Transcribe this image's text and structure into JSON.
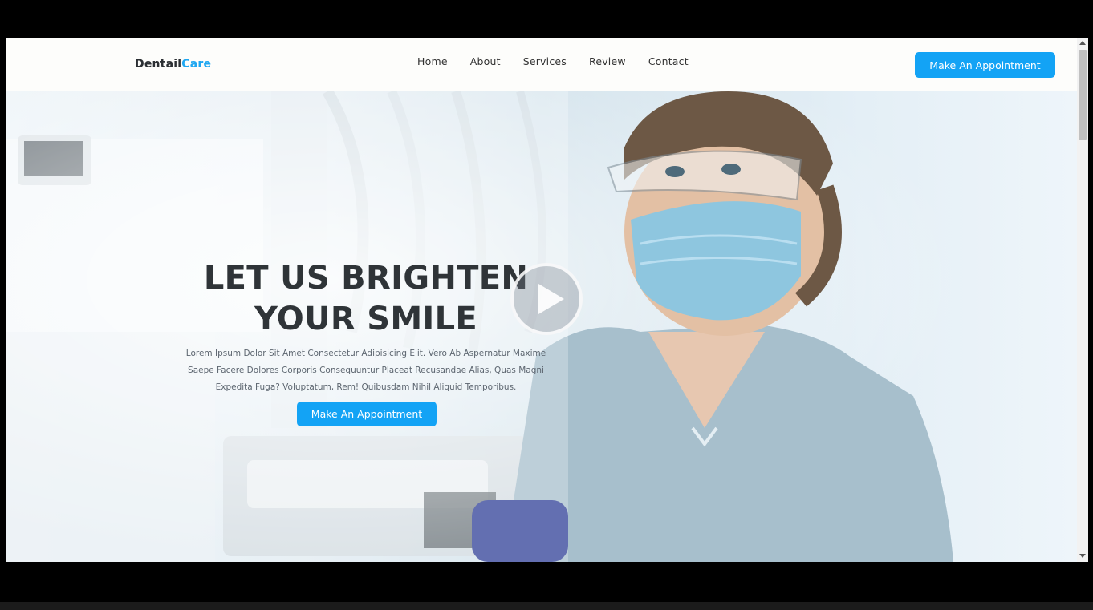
{
  "logo": {
    "brand": "Dentail",
    "accent": "Care"
  },
  "nav": {
    "items": [
      {
        "label": "Home"
      },
      {
        "label": "About"
      },
      {
        "label": "Services"
      },
      {
        "label": "Review"
      },
      {
        "label": "Contact"
      }
    ],
    "cta_label": "Make An Appointment"
  },
  "hero": {
    "title_line1": "LET US BRIGHTEN",
    "title_line2": "YOUR SMILE",
    "text": "Lorem Ipsum Dolor Sit Amet Consectetur Adipisicing Elit. Vero Ab Aspernatur Maxime Saepe Facere Dolores Corporis Consequuntur Placeat Recusandae Alias, Quas Magni Expedita Fuga? Voluptatum, Rem! Quibusdam Nihil Aliquid Temporibus.",
    "cta_label": "Make An Appointment",
    "play_icon": "play-icon"
  },
  "colors": {
    "accent": "#13a3f5",
    "logo_accent": "#1fa7f1",
    "heading": "#2f3438",
    "nav_bg": "#fdfdfb"
  }
}
